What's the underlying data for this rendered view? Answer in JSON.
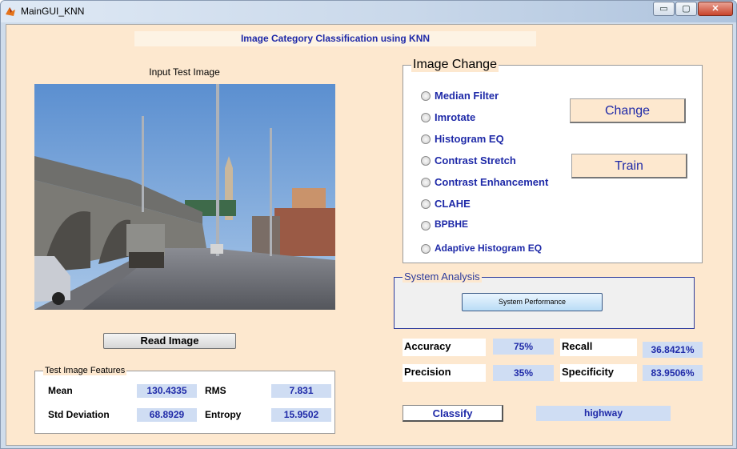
{
  "window": {
    "title": "MainGUI_KNN",
    "controls": {
      "minimize": "▭",
      "maximize": "▢",
      "close": "✕"
    }
  },
  "header": {
    "title": "Image Category Classification using KNN"
  },
  "input": {
    "label": "Input Test Image",
    "image_icon": "highway-street-photo",
    "read_button": "Read Image"
  },
  "features": {
    "legend": "Test Image Features",
    "mean_label": "Mean",
    "mean_value": "130.4335",
    "rms_label": "RMS",
    "rms_value": "7.831",
    "std_label": "Std Deviation",
    "std_value": "68.8929",
    "entropy_label": "Entropy",
    "entropy_value": "15.9502"
  },
  "image_change": {
    "legend": "Image Change",
    "options": [
      "Median Filter",
      "Imrotate",
      "Histogram EQ",
      "Contrast Stretch",
      "Contrast Enhancement",
      "CLAHE",
      "BPBHE",
      "Adaptive Histogram EQ"
    ],
    "change_button": "Change",
    "train_button": "Train"
  },
  "system_analysis": {
    "legend": "System Analysis",
    "performance_button": "System Performance"
  },
  "metrics": {
    "accuracy_label": "Accuracy",
    "accuracy_value": "75%",
    "recall_label": "Recall",
    "recall_value": "36.8421%",
    "precision_label": "Precision",
    "precision_value": "35%",
    "specificity_label": "Specificity",
    "specificity_value": "83.9506%"
  },
  "classify": {
    "button": "Classify",
    "result": "highway"
  },
  "colors": {
    "panel_bg": "#fde8cf",
    "value_bg": "#cfddf3",
    "accent_text": "#1f2aa8"
  }
}
